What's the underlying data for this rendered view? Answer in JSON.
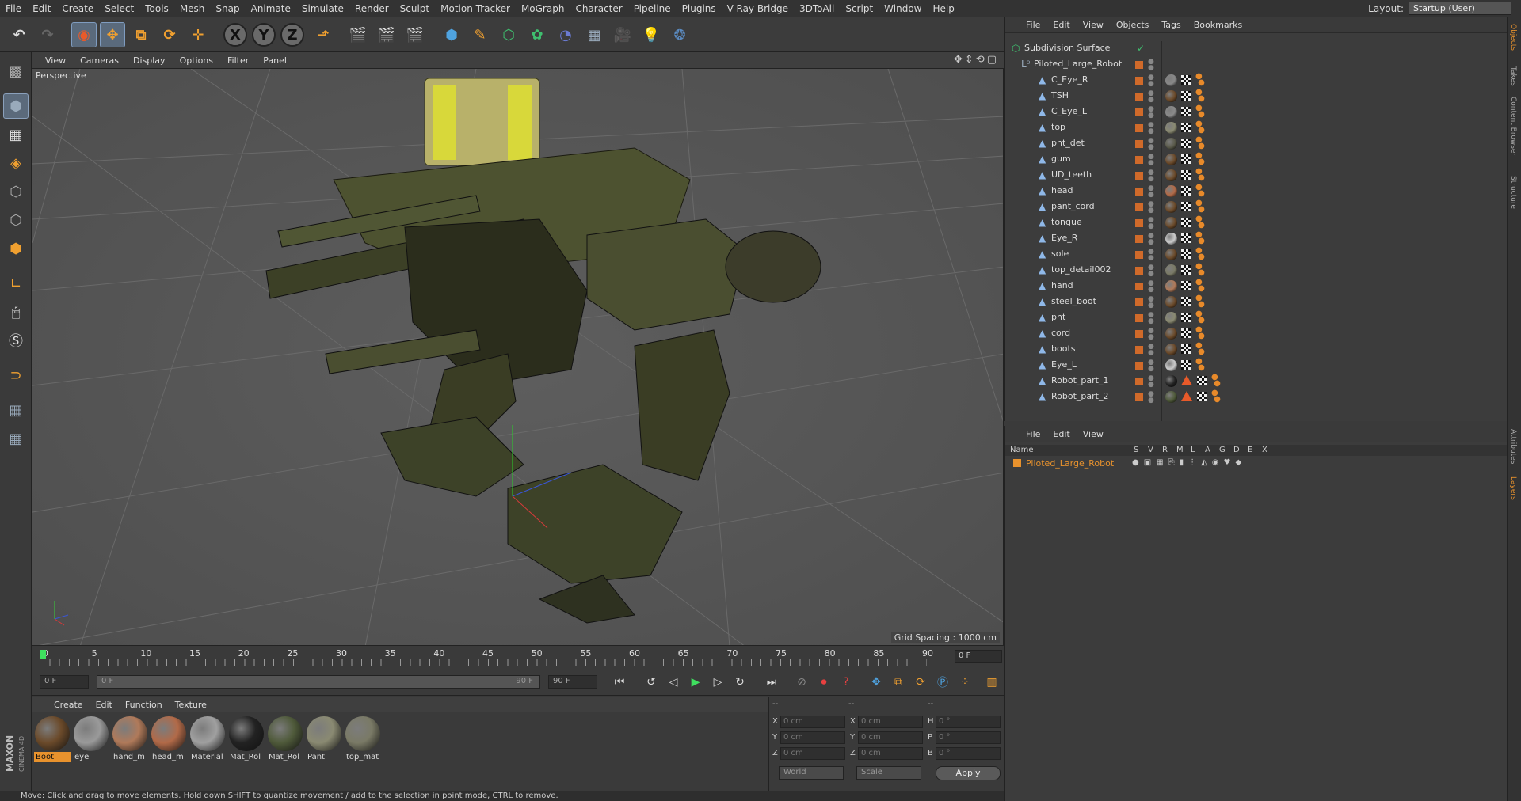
{
  "menubar": {
    "items": [
      "File",
      "Edit",
      "Create",
      "Select",
      "Tools",
      "Mesh",
      "Snap",
      "Animate",
      "Simulate",
      "Render",
      "Sculpt",
      "Motion Tracker",
      "MoGraph",
      "Character",
      "Pipeline",
      "Plugins",
      "V-Ray Bridge",
      "3DToAll",
      "Script",
      "Window",
      "Help"
    ],
    "layout_label": "Layout:",
    "layout_value": "Startup (User)"
  },
  "toolbar": {
    "axis_x": "X",
    "axis_y": "Y",
    "axis_z": "Z"
  },
  "viewport": {
    "menu": [
      "View",
      "Cameras",
      "Display",
      "Options",
      "Filter",
      "Panel"
    ],
    "camera_label": "Perspective",
    "grid_spacing": "Grid Spacing : 1000 cm"
  },
  "timeline": {
    "ticks": [
      "0",
      "5",
      "10",
      "15",
      "20",
      "25",
      "30",
      "35",
      "40",
      "45",
      "50",
      "55",
      "60",
      "65",
      "70",
      "75",
      "80",
      "85",
      "90"
    ],
    "current_frame": "0 F"
  },
  "transport": {
    "start_field": "0 F",
    "range_start": "0 F",
    "range_end": "90 F",
    "end_field": "90 F"
  },
  "material_manager": {
    "menu": [
      "Create",
      "Edit",
      "Function",
      "Texture"
    ],
    "materials": [
      {
        "label": "Boot",
        "color": "#6b4a2a"
      },
      {
        "label": "eye",
        "color": "#9a9a9a"
      },
      {
        "label": "hand_m",
        "color": "#b07a5a"
      },
      {
        "label": "head_m",
        "color": "#b26a48"
      },
      {
        "label": "Material",
        "color": "#a0a0a0"
      },
      {
        "label": "Mat_Rol",
        "color": "#222222"
      },
      {
        "label": "Mat_Rol",
        "color": "#4f5a3a"
      },
      {
        "label": "Pant",
        "color": "#8a8a72"
      },
      {
        "label": "top_mat",
        "color": "#7a7a66"
      }
    ]
  },
  "coordinates": {
    "header_left": "--",
    "header_mid": "--",
    "header_right": "--",
    "rows": [
      {
        "a": "X",
        "av": "0 cm",
        "b": "X",
        "bv": "0 cm",
        "c": "H",
        "cv": "0 °"
      },
      {
        "a": "Y",
        "av": "0 cm",
        "b": "Y",
        "bv": "0 cm",
        "c": "P",
        "cv": "0 °"
      },
      {
        "a": "Z",
        "av": "0 cm",
        "b": "Z",
        "bv": "0 cm",
        "c": "B",
        "cv": "0 °"
      }
    ],
    "world_select": "World",
    "scale_select": "Scale",
    "apply_label": "Apply"
  },
  "status": {
    "text": "Move: Click and drag to move elements. Hold down SHIFT to quantize movement / add to the selection in point mode, CTRL to remove."
  },
  "objects_panel": {
    "menu": [
      "File",
      "Edit",
      "View",
      "Objects",
      "Tags",
      "Bookmarks"
    ],
    "root": "Subdivision Surface",
    "group": "Piloted_Large_Robot",
    "items": [
      "C_Eye_R",
      "TSH",
      "C_Eye_L",
      "top",
      "pnt_det",
      "gum",
      "UD_teeth",
      "head",
      "pant_cord",
      "tongue",
      "Eye_R",
      "sole",
      "top_detail002",
      "hand",
      "steel_boot",
      "pnt",
      "cord",
      "boots",
      "Eye_L",
      "Robot_part_1",
      "Robot_part_2"
    ],
    "tag_colors": [
      "#888888",
      "#6b4a2a",
      "#8a8a8a",
      "#8a8a72",
      "#5a5a4a",
      "#6b4a2a",
      "#6b4a2a",
      "#b26a48",
      "#6b4a2a",
      "#6b4a2a",
      "#cccccc",
      "#6b4a2a",
      "#7a7a66",
      "#b07a5a",
      "#6b4a2a",
      "#8a8a72",
      "#6b4a2a",
      "#6b4a2a",
      "#cccccc",
      "#222222",
      "#4f5a3a"
    ]
  },
  "layers_panel": {
    "menu": [
      "File",
      "Edit",
      "View"
    ],
    "columns": [
      "Name",
      "S",
      "V",
      "R",
      "M",
      "L",
      "A",
      "G",
      "D",
      "E",
      "X"
    ],
    "layer_name": "Piloted_Large_Robot"
  },
  "side_tabs": [
    "Objects",
    "Takes",
    "Content Browser",
    "Structure",
    "Attributes",
    "Layers"
  ],
  "brand": "MAXON CINEMA 4D",
  "colors": {
    "accent_orange": "#e8922d",
    "layer_name": "#e8922d"
  }
}
